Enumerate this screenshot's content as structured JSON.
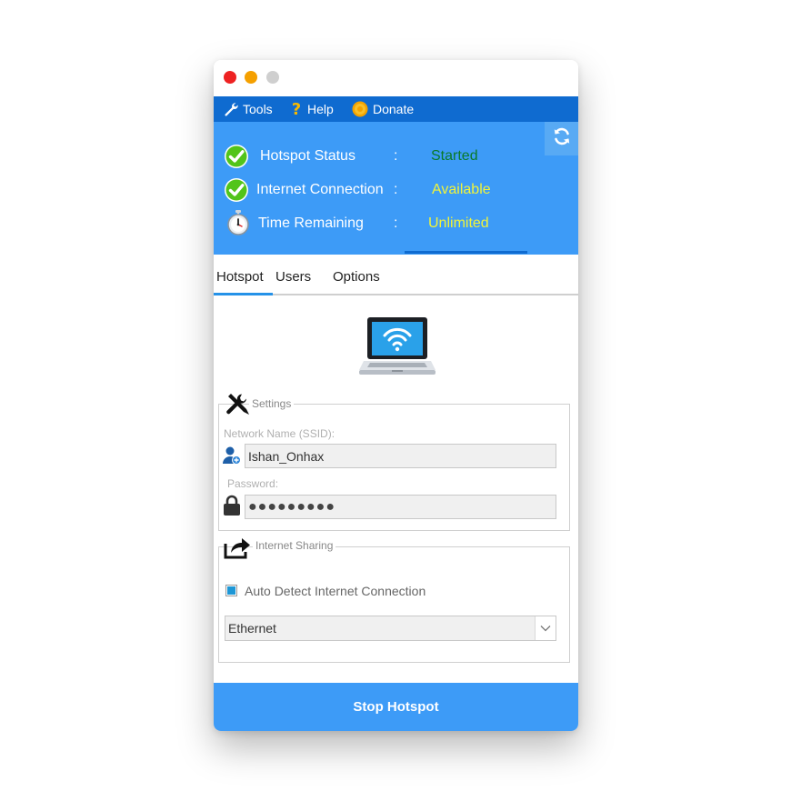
{
  "menu": {
    "tools": "Tools",
    "help": "Help",
    "donate": "Donate"
  },
  "status": {
    "rows": [
      {
        "label": "Hotspot Status",
        "colon": ":",
        "value": "Started",
        "value_color": "#0a7a2b",
        "icon": "check-icon"
      },
      {
        "label": "Internet Connection",
        "colon": ":",
        "value": "Available",
        "value_color": "#f0f33a",
        "icon": "check-icon"
      },
      {
        "label": "Time Remaining",
        "colon": ":",
        "value": "Unlimited",
        "value_color": "#f0f33a",
        "icon": "stopwatch-icon"
      }
    ]
  },
  "tabs": [
    {
      "label": "Hotspot",
      "active": true
    },
    {
      "label": "Users",
      "active": false
    },
    {
      "label": "Options",
      "active": false
    }
  ],
  "settings": {
    "title": "Settings",
    "ssid_label": "Network Name (SSID):",
    "ssid_value": "Ishan_Onhax",
    "password_label": "Password:",
    "password_value": "●●●●●●●●●"
  },
  "sharing": {
    "title": "Internet Sharing",
    "auto_detect_label": "Auto Detect Internet Connection",
    "auto_detect_checked": true,
    "connection_value": "Ethernet"
  },
  "stop_button": "Stop Hotspot",
  "colors": {
    "menubar": "#0f6bd0",
    "status_panel": "#3d9bf7",
    "accent": "#2592e8",
    "button": "#3d9bf7"
  }
}
